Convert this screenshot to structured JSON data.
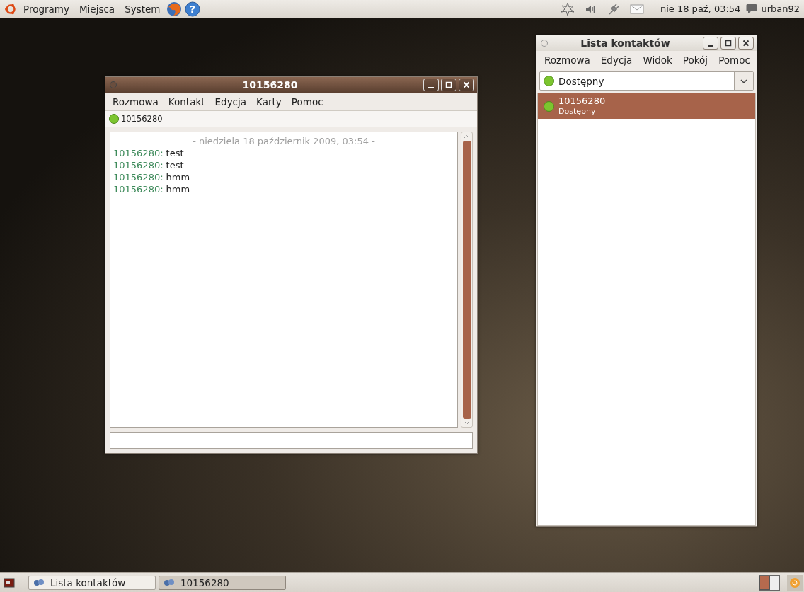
{
  "top_panel": {
    "menus": [
      "Programy",
      "Miejsca",
      "System"
    ],
    "help_glyph": "?",
    "clock": "nie 18 paź, 03:54",
    "user": "urban92"
  },
  "windows": [
    {
      "kind": "chat",
      "title": "10156280",
      "active": true,
      "menus": [
        "Rozmowa",
        "Kontakt",
        "Edycja",
        "Karty",
        "Pomoc"
      ],
      "contact": "10156280",
      "date_line": "- niedziela 18 październik 2009, 03:54 -",
      "messages": [
        {
          "sender": "10156280:",
          "text": "test"
        },
        {
          "sender": "10156280:",
          "text": "test"
        },
        {
          "sender": "10156280:",
          "text": "hmm"
        },
        {
          "sender": "10156280:",
          "text": "hmm"
        }
      ]
    },
    {
      "kind": "contacts",
      "title": "Lista kontaktów",
      "active": false,
      "menus": [
        "Rozmowa",
        "Edycja",
        "Widok",
        "Pokój",
        "Pomoc"
      ],
      "status": "Dostępny",
      "contacts": [
        {
          "name": "10156280",
          "status": "Dostępny",
          "selected": true
        }
      ]
    }
  ],
  "taskbar": [
    {
      "label": "Lista kontaktów",
      "selected": false
    },
    {
      "label": "10156280",
      "selected": true
    }
  ]
}
